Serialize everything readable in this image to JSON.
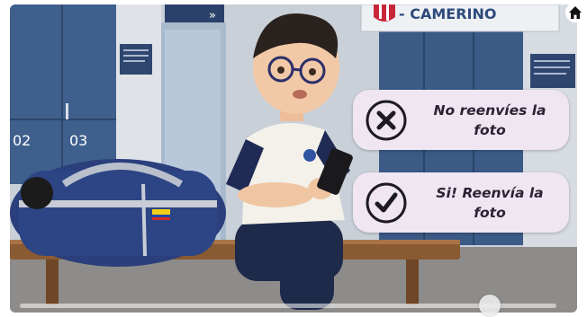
{
  "scene": {
    "locker_numbers": [
      "02",
      "03"
    ],
    "door_sign_text": "",
    "banner_text": "- CAMERINO"
  },
  "choices": [
    {
      "label": "No reenvíes la foto",
      "icon": "close-circle-icon"
    },
    {
      "label": "Si! Reenvía la foto",
      "icon": "check-circle-icon"
    }
  ],
  "controls": {
    "home_icon": "home-icon",
    "scrubber_progress": 0.875
  },
  "colors": {
    "choice_bg": "#efe6f2",
    "choice_text": "#2d2233",
    "locker_blue": "#3c5a86",
    "bag_blue": "#2a3f7c"
  }
}
